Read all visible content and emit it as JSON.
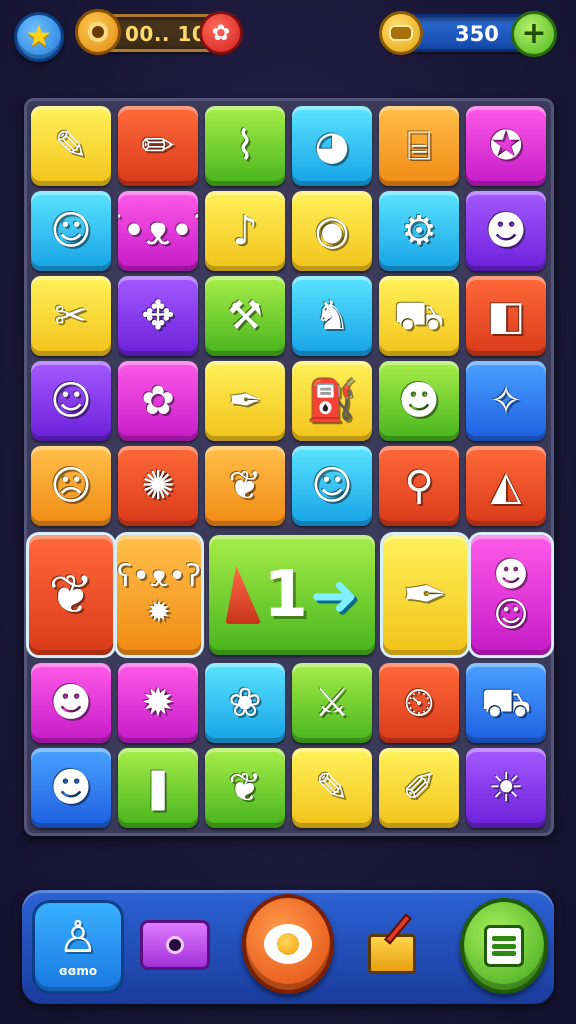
{
  "topbar": {
    "star_icon": "star-icon",
    "timer_text": "00.. 10",
    "timer_badge": "✿",
    "coins_text": "350",
    "plus_label": "+"
  },
  "board": {
    "tiles": [
      {
        "color": "yellow",
        "icon": "✎",
        "name": "pen-tool-icon"
      },
      {
        "color": "red",
        "icon": "✏",
        "name": "pencil-icon"
      },
      {
        "color": "green",
        "icon": "⌇",
        "name": "bean-icon"
      },
      {
        "color": "cyan",
        "icon": "◕",
        "name": "ball-icon"
      },
      {
        "color": "orange",
        "icon": "⌸",
        "name": "camera-icon"
      },
      {
        "color": "magenta",
        "icon": "✪",
        "name": "bird-icon"
      },
      {
        "color": "cyan",
        "icon": "☺",
        "name": "blob-face-icon"
      },
      {
        "color": "magenta",
        "icon": "ʕ•ᴥ•ʔ",
        "name": "bear-face-icon"
      },
      {
        "color": "yellow",
        "icon": "♪",
        "name": "rattle-icon"
      },
      {
        "color": "yellow",
        "icon": "◉",
        "name": "eye-blob-icon"
      },
      {
        "color": "cyan",
        "icon": "⚙",
        "name": "gear-icon"
      },
      {
        "color": "purple",
        "icon": "☻",
        "name": "cat-face-icon"
      },
      {
        "color": "yellow",
        "icon": "✂",
        "name": "bottle-icon"
      },
      {
        "color": "purple",
        "icon": "✥",
        "name": "clover-icon"
      },
      {
        "color": "green",
        "icon": "⚒",
        "name": "tool-icon"
      },
      {
        "color": "cyan",
        "icon": "♞",
        "name": "fox-face-icon"
      },
      {
        "color": "yellow",
        "icon": "⛟",
        "name": "truck-icon"
      },
      {
        "color": "red",
        "icon": "◧",
        "name": "flag-icon"
      },
      {
        "color": "purple",
        "icon": "☺",
        "name": "cat-icon"
      },
      {
        "color": "magenta",
        "icon": "✿",
        "name": "bug-icon"
      },
      {
        "color": "yellow",
        "icon": "✒",
        "name": "pen-nib-icon"
      },
      {
        "color": "yellow",
        "icon": "⛽",
        "name": "cup-icon"
      },
      {
        "color": "green",
        "icon": "☻",
        "name": "bear-icon"
      },
      {
        "color": "blue",
        "icon": "✧",
        "name": "feather-icon"
      },
      {
        "color": "orange",
        "icon": "☹",
        "name": "hedgehog-icon"
      },
      {
        "color": "red",
        "icon": "✺",
        "name": "spider-icon"
      },
      {
        "color": "orange",
        "icon": "❦",
        "name": "leaf-icon"
      },
      {
        "color": "cyan",
        "icon": "☺",
        "name": "fox-icon"
      },
      {
        "color": "red",
        "icon": "⚲",
        "name": "magnifier-icon"
      },
      {
        "color": "red",
        "icon": "◭",
        "name": "cheese-icon"
      },
      {
        "color": "magenta",
        "icon": "☻",
        "name": "chick-icon"
      },
      {
        "color": "magenta",
        "icon": "✹",
        "name": "beetle-icon"
      },
      {
        "color": "cyan",
        "icon": "❀",
        "name": "shell-icon"
      },
      {
        "color": "green",
        "icon": "⚔",
        "name": "pickaxe-icon"
      },
      {
        "color": "red",
        "icon": "⏲",
        "name": "clock-icon"
      },
      {
        "color": "blue",
        "icon": "⛟",
        "name": "van-icon"
      },
      {
        "color": "blue",
        "icon": "☻",
        "name": "creature-icon"
      },
      {
        "color": "green",
        "icon": "❚",
        "name": "candy-icon"
      },
      {
        "color": "green",
        "icon": "❦",
        "name": "brush-icon"
      },
      {
        "color": "yellow",
        "icon": "✎",
        "name": "crayon-icon"
      },
      {
        "color": "yellow",
        "icon": "✐",
        "name": "marker-icon"
      },
      {
        "color": "purple",
        "icon": "☀",
        "name": "sun-face-icon"
      }
    ],
    "special_row": {
      "palm": {
        "color": "red",
        "icon": "❦",
        "name": "palm-tree-icon"
      },
      "twins": {
        "color": "orange",
        "icon_top": "ʕ•ᴥ•ʔ",
        "icon_bottom": "✹",
        "name": "double-creature-icon"
      },
      "combo": {
        "number": "1",
        "arrow": "➜"
      },
      "tube": {
        "color": "yellow",
        "icon": "✒",
        "name": "tube-icon"
      },
      "pair": {
        "color": "magenta",
        "icon_top": "☻",
        "icon_bottom": "☺",
        "name": "double-pet-icon"
      }
    }
  },
  "bottombar": {
    "mode_label": "ɞɞmo",
    "mode_icon": "♙"
  },
  "colors": {
    "yellow": "#f2c21a",
    "orange": "#f08a14",
    "red": "#d93a1a",
    "green": "#46b41c",
    "cyan": "#16a2e6",
    "blue": "#1e5ee0",
    "magenta": "#c41ac8",
    "purple": "#6a20d8"
  }
}
